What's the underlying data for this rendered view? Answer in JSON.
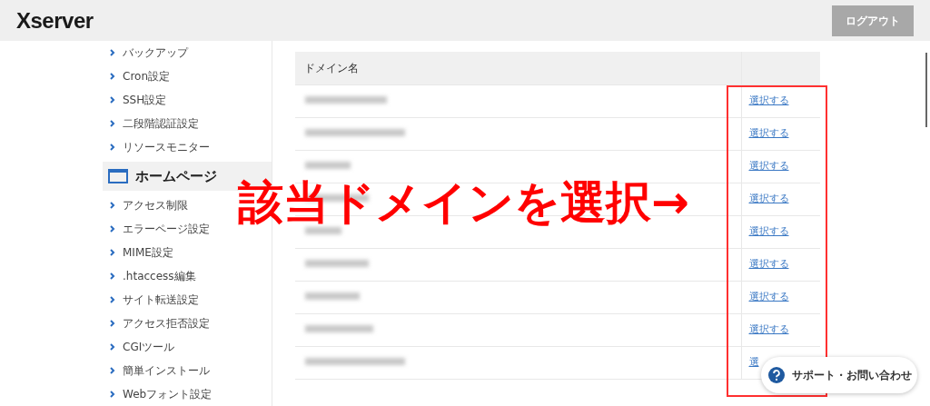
{
  "header": {
    "logo": "Xserver",
    "logout_button": "ログアウト"
  },
  "sidebar": {
    "groups": [
      {
        "items": [
          "バックアップ",
          "Cron設定",
          "SSH設定",
          "二段階認証設定",
          "リソースモニター"
        ]
      },
      {
        "heading": "ホームページ",
        "items": [
          "アクセス制限",
          "エラーページ設定",
          "MIME設定",
          ".htaccess編集",
          "サイト転送設定",
          "アクセス拒否設定",
          "CGIツール",
          "簡単インストール",
          "Webフォント設定"
        ]
      }
    ]
  },
  "table": {
    "columns": [
      "ドメイン名"
    ],
    "rows": [
      {
        "domain_blurred": true,
        "link": "選択する"
      },
      {
        "domain_blurred": true,
        "link": "選択する"
      },
      {
        "domain_blurred": true,
        "link": "選択する"
      },
      {
        "domain_blurred": true,
        "link": "選択する"
      },
      {
        "domain_blurred": true,
        "link": "選択する"
      },
      {
        "domain_blurred": true,
        "link": "選択する"
      },
      {
        "domain_blurred": true,
        "link": "選択する"
      },
      {
        "domain_blurred": true,
        "link": "選択する"
      },
      {
        "domain_blurred": true,
        "link": "選"
      }
    ]
  },
  "annotation": {
    "text": "該当ドメインを選択→"
  },
  "support_button": "サポート・お問い合わせ"
}
